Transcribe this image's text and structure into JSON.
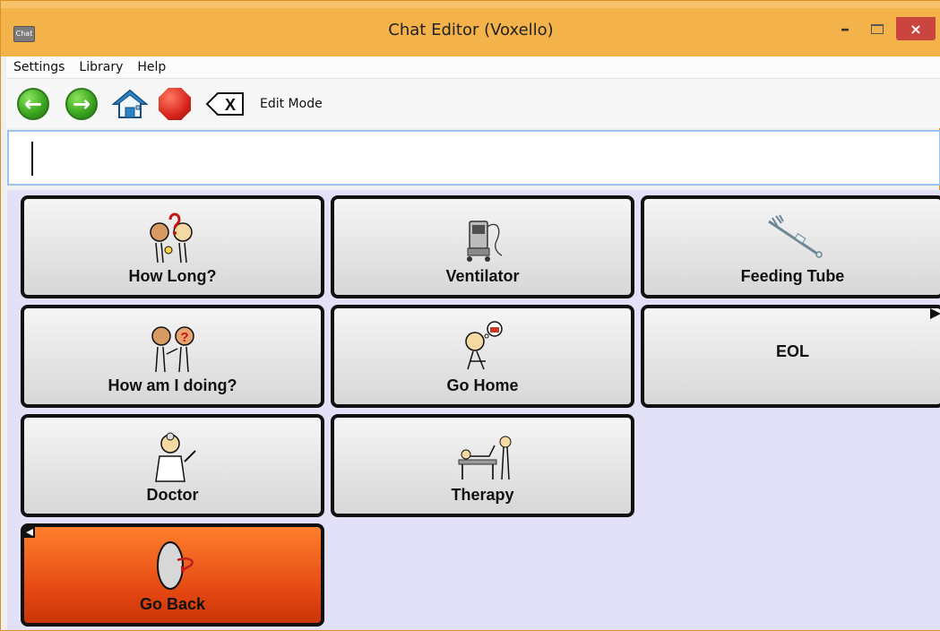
{
  "window": {
    "title": "Chat Editor (Voxello)",
    "app_icon_label": "Chat",
    "controls": {
      "minimize": "–",
      "close": "×"
    }
  },
  "menu": [
    "Settings",
    "Library",
    "Help"
  ],
  "toolbar": {
    "back_icon": "back-arrow-icon",
    "forward_icon": "forward-arrow-icon",
    "home_icon": "home-icon",
    "stop_icon": "stop-icon",
    "clear_icon": "clear-icon",
    "clear_label": "X",
    "edit_mode": "Edit Mode"
  },
  "message": {
    "value": ""
  },
  "board": {
    "cells": [
      {
        "label": "How Long?",
        "icon": "how-long-icon"
      },
      {
        "label": "Ventilator",
        "icon": "ventilator-icon"
      },
      {
        "label": "Feeding Tube",
        "icon": "feeding-tube-icon"
      },
      {
        "label": "How am I doing?",
        "icon": "how-am-i-doing-icon"
      },
      {
        "label": "Go Home",
        "icon": "go-home-icon"
      },
      {
        "label": "EOL",
        "icon": "folder-arrow-icon"
      },
      {
        "label": "Doctor",
        "icon": "doctor-icon"
      },
      {
        "label": "Therapy",
        "icon": "therapy-icon"
      },
      {
        "label": "Go Back",
        "icon": "go-back-icon"
      }
    ]
  },
  "colors": {
    "title_bar": "#f4b24a",
    "board_bg": "#e3e1f8",
    "cell_bg": "#e6e6e6",
    "go_back_bg": "#e24511",
    "close_button": "#c9453e"
  }
}
